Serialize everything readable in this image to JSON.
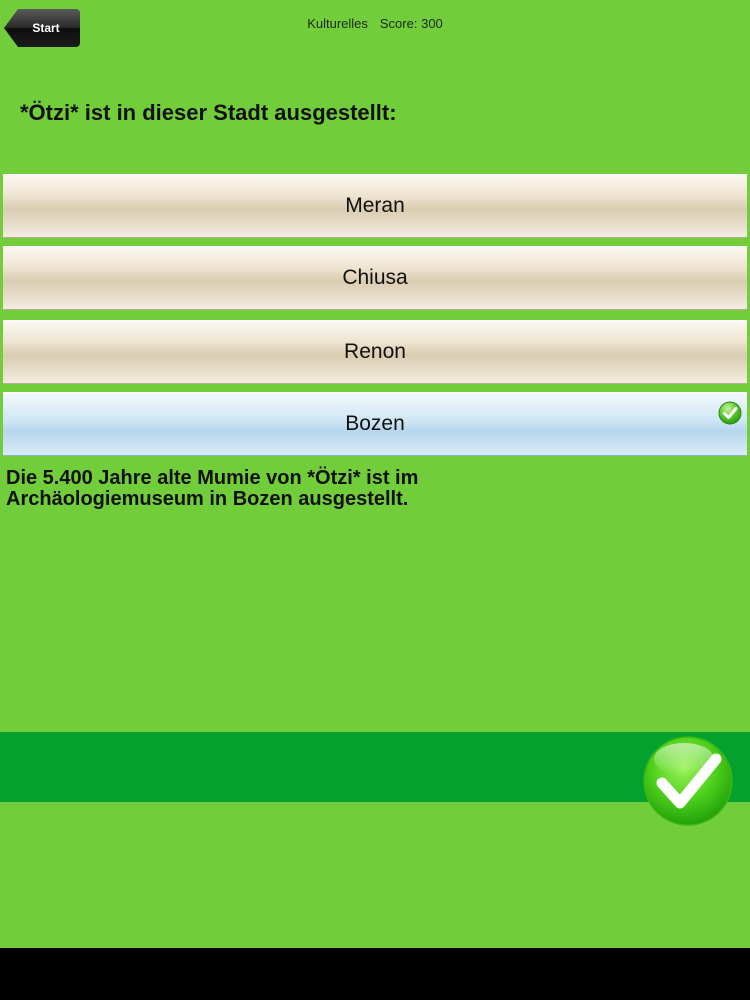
{
  "header": {
    "back_label": "Start",
    "category": "Kulturelles",
    "score_label": "Score:",
    "score_value": "300"
  },
  "question": "*Ötzi* ist in dieser Stadt ausgestellt:",
  "answers": [
    {
      "label": "Meran",
      "correct": false
    },
    {
      "label": "Chiusa",
      "correct": false
    },
    {
      "label": "Renon",
      "correct": false
    },
    {
      "label": "Bozen",
      "correct": true
    }
  ],
  "explanation": "Die 5.400 Jahre alte Mumie von *Ötzi* ist im Archäologiemuseum in Bozen ausgestellt.",
  "icons": {
    "correct_marker": "checkmark-icon",
    "next_button": "checkmark-icon"
  },
  "colors": {
    "background": "#72cd3b",
    "bottom_bar": "#05a12f",
    "correct_answer": "#cfe6f5",
    "answer": "#ede3cf"
  }
}
